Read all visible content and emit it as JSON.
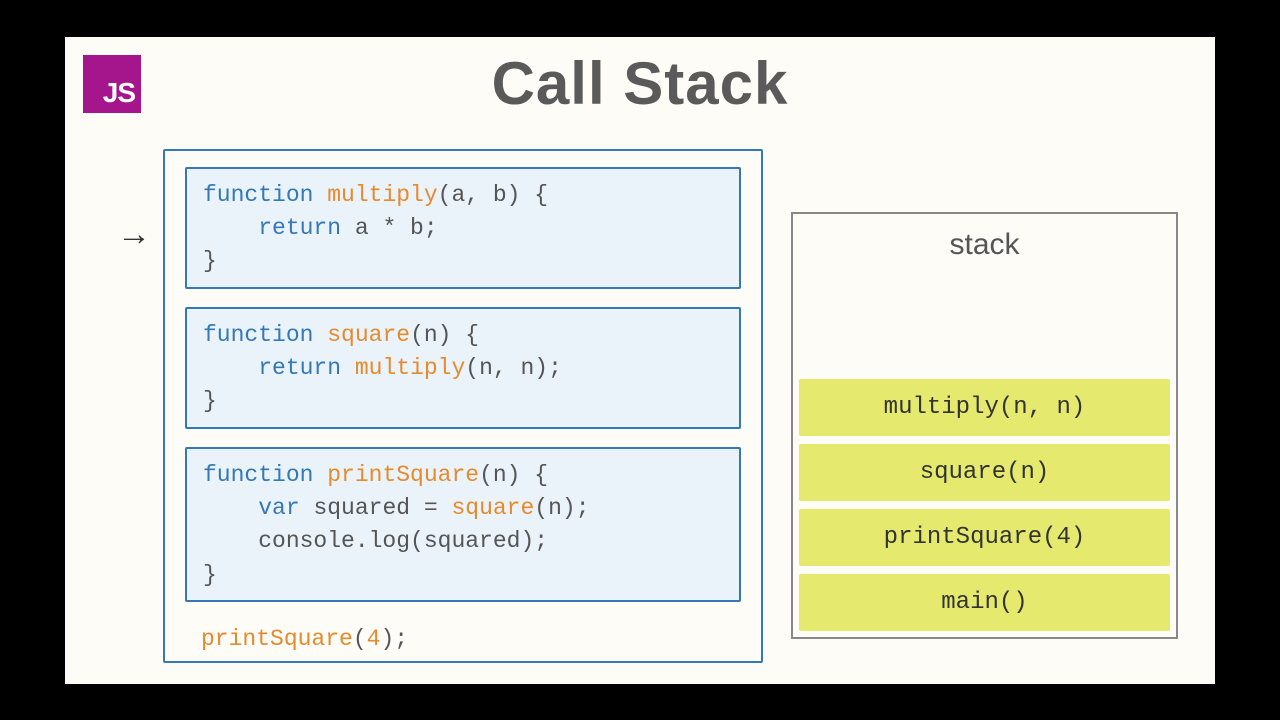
{
  "logo": "JS",
  "title": "Call Stack",
  "arrow": "→",
  "code": {
    "multiply": {
      "l1a": "function",
      "l1b": " ",
      "l1c": "multiply",
      "l1d": "(a, b) {",
      "l2a": "    ",
      "l2b": "return",
      "l2c": " a * b;",
      "l3": "}"
    },
    "square": {
      "l1a": "function",
      "l1b": " ",
      "l1c": "square",
      "l1d": "(n) {",
      "l2a": "    ",
      "l2b": "return",
      "l2c": " ",
      "l2d": "multiply",
      "l2e": "(n, n);",
      "l3": "}"
    },
    "printSquare": {
      "l1a": "function",
      "l1b": " ",
      "l1c": "printSquare",
      "l1d": "(n) {",
      "l2a": "    ",
      "l2b": "var",
      "l2c": " squared = ",
      "l2d": "square",
      "l2e": "(n);",
      "l3": "    console.log(squared);",
      "l4": "}"
    },
    "call": {
      "a": "printSquare",
      "b": "(",
      "c": "4",
      "d": ");"
    }
  },
  "stack": {
    "title": "stack",
    "frames": [
      "multiply(n, n)",
      "square(n)",
      "printSquare(4)",
      "main()"
    ]
  }
}
